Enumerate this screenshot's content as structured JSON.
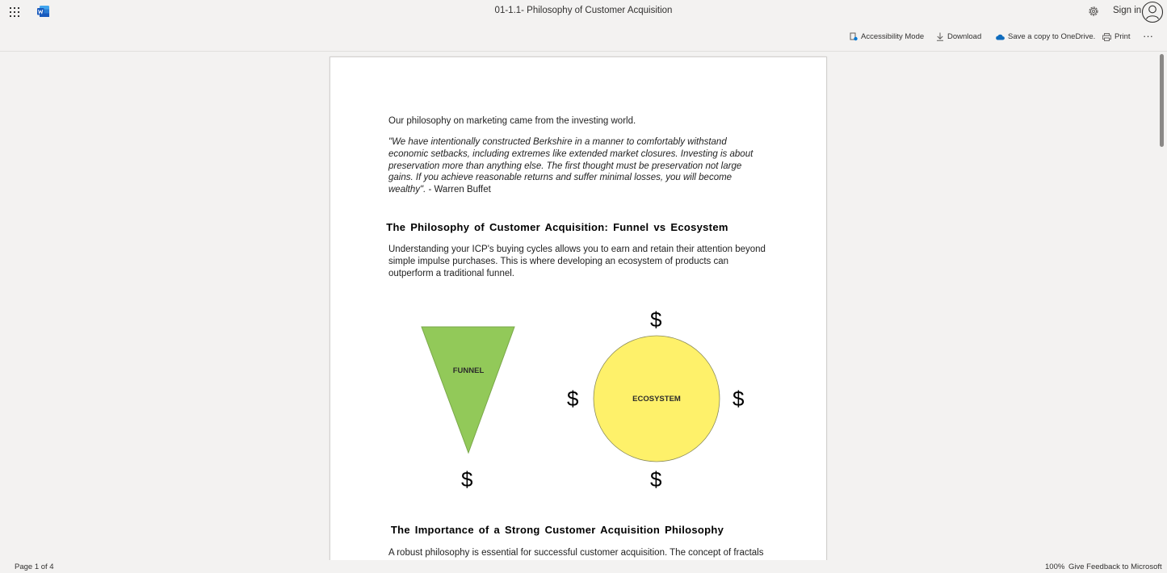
{
  "header": {
    "doc_title": "01-1.1- Philosophy of Customer Acquisition",
    "sign_in": "Sign in",
    "icons": [
      "app-launcher-icon",
      "word-logo-icon",
      "gear-icon",
      "avatar-icon"
    ]
  },
  "toolbar": {
    "accessibility": "Accessibility Mode",
    "download": "Download",
    "save_onedrive": "Save a copy to OneDrive.",
    "print": "Print",
    "more": "···"
  },
  "document": {
    "intro": "Our philosophy on marketing came from the investing world.",
    "quote": "\"We have intentionally constructed Berkshire in a manner to comfortably withstand economic setbacks, including extremes like extended market closures. Investing is about preservation more than anything else. The first thought must be preservation not large gains. If you achieve reasonable returns and suffer minimal losses, you will become wealthy\".",
    "attribution": " - Warren Buffet",
    "heading1": "The Philosophy of Customer Acquisition: Funnel vs Ecosystem",
    "para1": "Understanding your ICP's buying cycles allows you to earn and retain their attention beyond simple impulse purchases. This is where developing an ecosystem of products can outperform a traditional funnel.",
    "diagram": {
      "funnel_label": "FUNNEL",
      "ecosystem_label": "ECOSYSTEM",
      "dollar_symbol": "$",
      "funnel_color": "#92c959",
      "ecosystem_color": "#fef16a"
    },
    "heading2": "The Importance of a Strong Customer Acquisition Philosophy",
    "para2": "A robust philosophy is essential for successful customer acquisition. The concept of fractals in"
  },
  "status": {
    "page_info": "Page 1 of 4",
    "zoom": "100%",
    "feedback": "Give Feedback to Microsoft"
  }
}
